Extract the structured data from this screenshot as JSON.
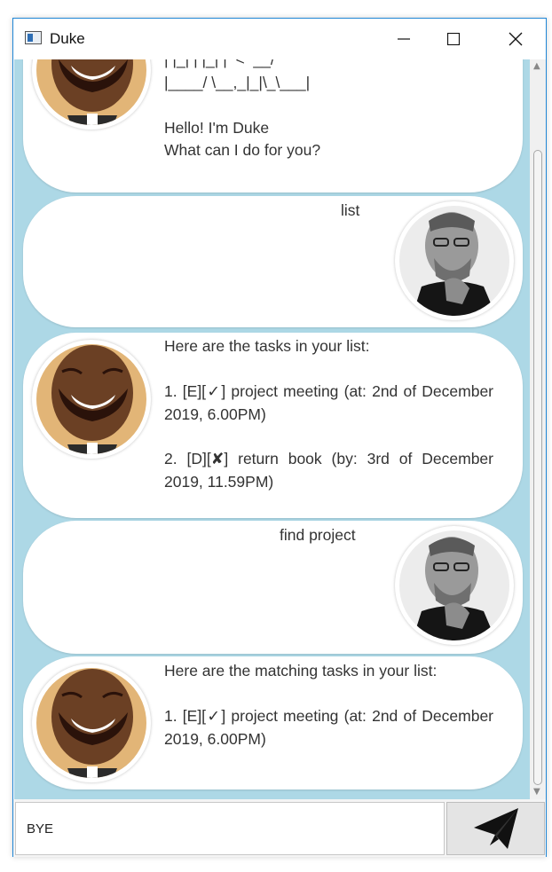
{
  "window": {
    "title": "Duke"
  },
  "messages": [
    {
      "sender": "duke",
      "lines": [
        "| |_| | |_| |  <  __/",
        "|____/ \\__,_|_|\\_\\___|",
        "",
        "Hello! I'm Duke",
        "What can I do for you?"
      ]
    },
    {
      "sender": "user",
      "text": "list"
    },
    {
      "sender": "duke",
      "header": "Here are the tasks in your list:",
      "items": [
        "1. [E][✓] project meeting (at: 2nd of December 2019, 6.00PM)",
        "2. [D][✘] return book (by: 3rd of December 2019, 11.59PM)"
      ]
    },
    {
      "sender": "user",
      "text": "find project"
    },
    {
      "sender": "duke",
      "header": "Here are the matching tasks in your list:",
      "items": [
        "1. [E][✓] project meeting (at: 2nd of December 2019, 6.00PM)"
      ]
    }
  ],
  "input": {
    "value": "BYE"
  },
  "icons": {
    "send": "paper-plane-icon",
    "user_avatar": "user-avatar",
    "duke_avatar": "duke-avatar"
  },
  "colors": {
    "chat_background": "#add8e6",
    "bubble": "#ffffff",
    "window_border": "#1f86d6"
  }
}
